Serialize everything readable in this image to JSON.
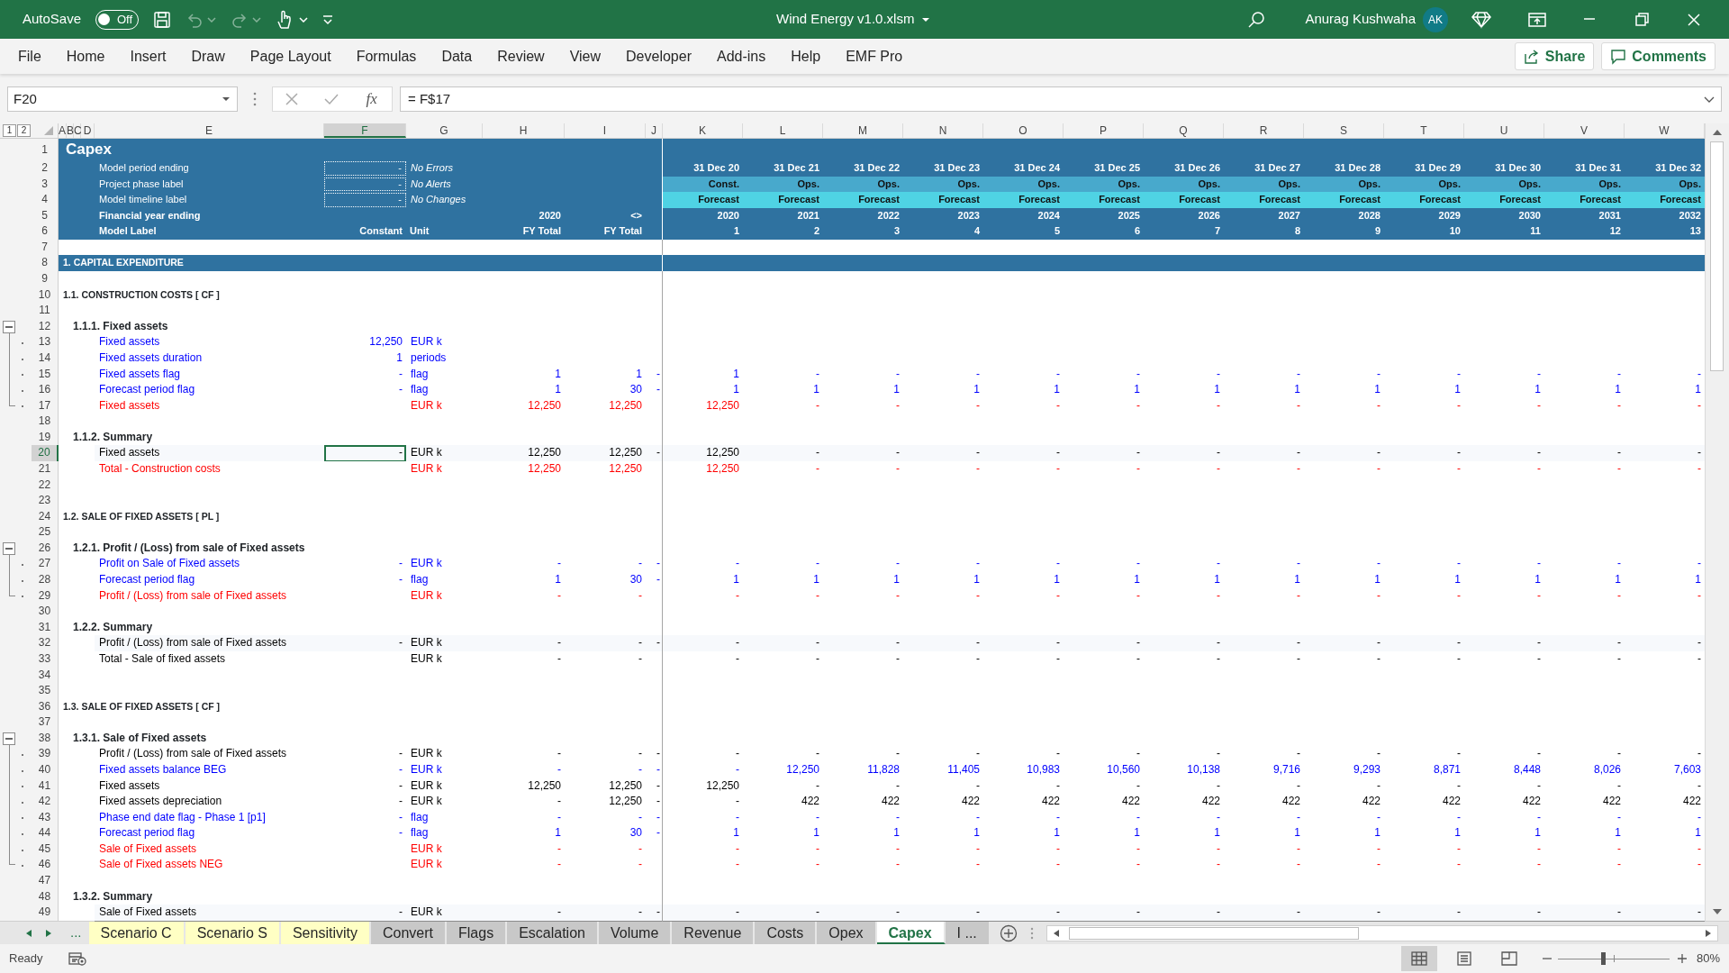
{
  "title_bar": {
    "autosave": {
      "label": "AutoSave",
      "on": false,
      "state_text": "Off"
    },
    "undo_disabled": true,
    "redo_disabled": true,
    "file_title": "Wind Energy v1.0.xlsm",
    "user_name": "Anurag Kushwaha",
    "avatar_initials": "AK"
  },
  "menu": [
    "File",
    "Home",
    "Insert",
    "Draw",
    "Page Layout",
    "Formulas",
    "Data",
    "Review",
    "View",
    "Developer",
    "Add-ins",
    "Help",
    "EMF Pro"
  ],
  "ribbon_actions": [
    "Share",
    "Comments"
  ],
  "formula_bar": {
    "name_box": "F20",
    "function_label": "fx",
    "formula": "= F$17"
  },
  "outline_levels": [
    "1",
    "2"
  ],
  "columns": [
    {
      "letter": "A",
      "selected": false
    },
    {
      "letter": "B",
      "selected": false
    },
    {
      "letter": "C",
      "selected": false
    },
    {
      "letter": "D",
      "selected": false
    },
    {
      "letter": "E",
      "selected": false
    },
    {
      "letter": "F",
      "selected": true
    },
    {
      "letter": "G",
      "selected": false
    },
    {
      "letter": "H",
      "selected": false
    },
    {
      "letter": "I",
      "selected": false
    },
    {
      "letter": "J",
      "selected": false
    },
    {
      "letter": "K",
      "selected": false
    },
    {
      "letter": "L",
      "selected": false
    },
    {
      "letter": "M",
      "selected": false
    },
    {
      "letter": "N",
      "selected": false
    },
    {
      "letter": "O",
      "selected": false
    },
    {
      "letter": "P",
      "selected": false
    },
    {
      "letter": "Q",
      "selected": false
    },
    {
      "letter": "R",
      "selected": false
    },
    {
      "letter": "S",
      "selected": false
    },
    {
      "letter": "T",
      "selected": false
    },
    {
      "letter": "U",
      "selected": false
    },
    {
      "letter": "V",
      "selected": false
    },
    {
      "letter": "W",
      "selected": false
    }
  ],
  "rows": [
    {
      "number": "1",
      "kind": "title",
      "selected": false,
      "label": "Capex"
    },
    {
      "number": "2",
      "kind": "check",
      "selected": false,
      "label": "Model period ending",
      "constant": "-",
      "unit": "No Errors",
      "periods": [
        "31 Dec 20",
        "31 Dec 21",
        "31 Dec 22",
        "31 Dec 23",
        "31 Dec 24",
        "31 Dec 25",
        "31 Dec 26",
        "31 Dec 27",
        "31 Dec 28",
        "31 Dec 29",
        "31 Dec 30",
        "31 Dec 31",
        "31 Dec 32"
      ]
    },
    {
      "number": "3",
      "kind": "phase",
      "selected": false,
      "label": "Project phase label",
      "constant": "-",
      "unit": "No Alerts",
      "periods": [
        "Const.",
        "Ops.",
        "Ops.",
        "Ops.",
        "Ops.",
        "Ops.",
        "Ops.",
        "Ops.",
        "Ops.",
        "Ops.",
        "Ops.",
        "Ops.",
        "Ops."
      ]
    },
    {
      "number": "4",
      "kind": "timeline",
      "selected": false,
      "label": "Model timeline label",
      "constant": "-",
      "unit": "No Changes",
      "periods": [
        "Forecast",
        "Forecast",
        "Forecast",
        "Forecast",
        "Forecast",
        "Forecast",
        "Forecast",
        "Forecast",
        "Forecast",
        "Forecast",
        "Forecast",
        "Forecast",
        "Forecast"
      ]
    },
    {
      "number": "5",
      "kind": "header",
      "selected": false,
      "label": "Financial year ending",
      "col_h": "2020",
      "col_i": "<>",
      "periods": [
        "2020",
        "2021",
        "2022",
        "2023",
        "2024",
        "2025",
        "2026",
        "2027",
        "2028",
        "2029",
        "2030",
        "2031",
        "2032"
      ]
    },
    {
      "number": "6",
      "kind": "header",
      "selected": false,
      "label": "Model Label",
      "constant": "Constant",
      "unit": "Unit",
      "col_h": "FY Total",
      "col_i": "FY Total",
      "periods": [
        "1",
        "2",
        "3",
        "4",
        "5",
        "6",
        "7",
        "8",
        "9",
        "10",
        "11",
        "12",
        "13"
      ]
    },
    {
      "number": "7",
      "kind": "blank",
      "selected": false
    },
    {
      "number": "8",
      "kind": "section",
      "selected": false,
      "label": "1. CAPITAL EXPENDITURE"
    },
    {
      "number": "9",
      "kind": "blank",
      "selected": false
    },
    {
      "number": "10",
      "kind": "heading",
      "selected": false,
      "label": "1.1. CONSTRUCTION COSTS [ CF ]"
    },
    {
      "number": "11",
      "kind": "blank",
      "selected": false
    },
    {
      "number": "12",
      "kind": "subheading",
      "selected": false,
      "expanded": true,
      "label": "1.1.1. Fixed assets",
      "children": [
        {
          "number": "13",
          "kind": "item",
          "color": "#0000ff",
          "selected": false,
          "label": "Fixed assets",
          "constant": "12,250",
          "unit": "EUR k"
        },
        {
          "number": "14",
          "kind": "item",
          "color": "#0000ff",
          "selected": false,
          "label": "Fixed assets duration",
          "constant": "1",
          "unit": "periods"
        },
        {
          "number": "15",
          "kind": "item",
          "color": "#0000ff",
          "selected": false,
          "label": "Fixed assets flag",
          "constant": "-",
          "unit": "flag",
          "col_h": "1",
          "col_i": "1",
          "col_j": "-",
          "periods": [
            "1",
            "-",
            "-",
            "-",
            "-",
            "-",
            "-",
            "-",
            "-",
            "-",
            "-",
            "-",
            "-"
          ]
        },
        {
          "number": "16",
          "kind": "item",
          "color": "#0000ff",
          "selected": false,
          "label": "Forecast period flag",
          "constant": "-",
          "unit": "flag",
          "col_h": "1",
          "col_i": "30",
          "col_j": "-",
          "periods": [
            "1",
            "1",
            "1",
            "1",
            "1",
            "1",
            "1",
            "1",
            "1",
            "1",
            "1",
            "1",
            "1"
          ]
        },
        {
          "number": "17",
          "kind": "item",
          "color": "#ff0000",
          "selected": false,
          "label": "Fixed assets",
          "unit": "EUR k",
          "col_h": "12,250",
          "col_i": "12,250",
          "periods": [
            "12,250",
            "-",
            "-",
            "-",
            "-",
            "-",
            "-",
            "-",
            "-",
            "-",
            "-",
            "-",
            "-"
          ]
        }
      ]
    },
    {
      "number": "18",
      "kind": "blank",
      "selected": false
    },
    {
      "number": "19",
      "kind": "subheading",
      "selected": false,
      "label": "1.1.2. Summary"
    },
    {
      "number": "20",
      "kind": "summary",
      "color": "#000000",
      "selected": true,
      "label": "Fixed assets",
      "constant": "-",
      "unit": "EUR k",
      "col_h": "12,250",
      "col_i": "12,250",
      "col_j": "-",
      "periods": [
        "12,250",
        "-",
        "-",
        "-",
        "-",
        "-",
        "-",
        "-",
        "-",
        "-",
        "-",
        "-",
        "-"
      ]
    },
    {
      "number": "21",
      "kind": "total",
      "color": "#ff0000",
      "selected": false,
      "label": "Total - Construction costs",
      "unit": "EUR k",
      "col_h": "12,250",
      "col_i": "12,250",
      "periods": [
        "12,250",
        "-",
        "-",
        "-",
        "-",
        "-",
        "-",
        "-",
        "-",
        "-",
        "-",
        "-",
        "-"
      ]
    },
    {
      "number": "22",
      "kind": "blank",
      "selected": false
    },
    {
      "number": "23",
      "kind": "blank",
      "selected": false
    },
    {
      "number": "24",
      "kind": "heading",
      "selected": false,
      "label": "1.2. SALE OF FIXED ASSETS [ PL ]"
    },
    {
      "number": "25",
      "kind": "blank",
      "selected": false
    },
    {
      "number": "26",
      "kind": "subheading",
      "selected": false,
      "expanded": true,
      "label": "1.2.1. Profit / (Loss) from sale of Fixed assets",
      "children": [
        {
          "number": "27",
          "kind": "item",
          "color": "#0000ff",
          "selected": false,
          "label": "Profit on Sale of Fixed assets",
          "constant": "-",
          "unit": "EUR k",
          "col_h": "-",
          "col_i": "-",
          "col_j": "-",
          "periods": [
            "-",
            "-",
            "-",
            "-",
            "-",
            "-",
            "-",
            "-",
            "-",
            "-",
            "-",
            "-",
            "-"
          ]
        },
        {
          "number": "28",
          "kind": "item",
          "color": "#0000ff",
          "selected": false,
          "label": "Forecast period flag",
          "constant": "-",
          "unit": "flag",
          "col_h": "1",
          "col_i": "30",
          "col_j": "-",
          "periods": [
            "1",
            "1",
            "1",
            "1",
            "1",
            "1",
            "1",
            "1",
            "1",
            "1",
            "1",
            "1",
            "1"
          ]
        },
        {
          "number": "29",
          "kind": "item",
          "color": "#ff0000",
          "selected": false,
          "label": "Profit / (Loss) from sale of Fixed assets",
          "unit": "EUR k",
          "col_h": "-",
          "col_i": "-",
          "periods": [
            "-",
            "-",
            "-",
            "-",
            "-",
            "-",
            "-",
            "-",
            "-",
            "-",
            "-",
            "-",
            "-"
          ]
        }
      ]
    },
    {
      "number": "30",
      "kind": "blank",
      "selected": false
    },
    {
      "number": "31",
      "kind": "subheading",
      "selected": false,
      "label": "1.2.2. Summary"
    },
    {
      "number": "32",
      "kind": "summary",
      "color": "#000000",
      "selected": false,
      "label": "Profit / (Loss) from sale of Fixed assets",
      "constant": "-",
      "unit": "EUR k",
      "col_h": "-",
      "col_i": "-",
      "col_j": "-",
      "periods": [
        "-",
        "-",
        "-",
        "-",
        "-",
        "-",
        "-",
        "-",
        "-",
        "-",
        "-",
        "-",
        "-"
      ]
    },
    {
      "number": "33",
      "kind": "total",
      "color": "#000000",
      "selected": false,
      "label": "Total - Sale of fixed assets",
      "unit": "EUR k",
      "col_h": "-",
      "col_i": "-",
      "periods": [
        "-",
        "-",
        "-",
        "-",
        "-",
        "-",
        "-",
        "-",
        "-",
        "-",
        "-",
        "-",
        "-"
      ]
    },
    {
      "number": "34",
      "kind": "blank",
      "selected": false
    },
    {
      "number": "35",
      "kind": "blank",
      "selected": false
    },
    {
      "number": "36",
      "kind": "heading",
      "selected": false,
      "label": "1.3. SALE OF FIXED ASSETS [ CF ]"
    },
    {
      "number": "37",
      "kind": "blank",
      "selected": false
    },
    {
      "number": "38",
      "kind": "subheading",
      "selected": false,
      "expanded": true,
      "label": "1.3.1. Sale of Fixed assets",
      "children": [
        {
          "number": "39",
          "kind": "item",
          "color": "#000000",
          "selected": false,
          "label": "Profit / (Loss) from sale of Fixed assets",
          "constant": "-",
          "unit": "EUR k",
          "col_h": "-",
          "col_i": "-",
          "col_j": "-",
          "periods": [
            "-",
            "-",
            "-",
            "-",
            "-",
            "-",
            "-",
            "-",
            "-",
            "-",
            "-",
            "-",
            "-"
          ]
        },
        {
          "number": "40",
          "kind": "item",
          "color": "#0000ff",
          "selected": false,
          "label": "Fixed assets balance BEG",
          "constant": "-",
          "unit": "EUR k",
          "col_h": "-",
          "col_i": "-",
          "col_j": "-",
          "periods": [
            "-",
            "12,250",
            "11,828",
            "11,405",
            "10,983",
            "10,560",
            "10,138",
            "9,716",
            "9,293",
            "8,871",
            "8,448",
            "8,026",
            "7,603"
          ]
        },
        {
          "number": "41",
          "kind": "item",
          "color": "#000000",
          "selected": false,
          "label": "Fixed assets",
          "constant": "-",
          "unit": "EUR k",
          "col_h": "12,250",
          "col_i": "12,250",
          "col_j": "-",
          "periods": [
            "12,250",
            "-",
            "-",
            "-",
            "-",
            "-",
            "-",
            "-",
            "-",
            "-",
            "-",
            "-",
            "-"
          ]
        },
        {
          "number": "42",
          "kind": "item",
          "color": "#000000",
          "selected": false,
          "label": "Fixed assets depreciation",
          "constant": "-",
          "unit": "EUR k",
          "col_h": "-",
          "col_i": "12,250",
          "col_j": "-",
          "periods": [
            "-",
            "422",
            "422",
            "422",
            "422",
            "422",
            "422",
            "422",
            "422",
            "422",
            "422",
            "422",
            "422"
          ]
        },
        {
          "number": "43",
          "kind": "item",
          "color": "#0000ff",
          "selected": false,
          "label": "Phase end date flag - Phase 1 [p1]",
          "constant": "-",
          "unit": "flag",
          "col_h": "-",
          "col_i": "-",
          "col_j": "-",
          "periods": [
            "-",
            "-",
            "-",
            "-",
            "-",
            "-",
            "-",
            "-",
            "-",
            "-",
            "-",
            "-",
            "-"
          ]
        },
        {
          "number": "44",
          "kind": "item",
          "color": "#0000ff",
          "selected": false,
          "label": "Forecast period flag",
          "constant": "-",
          "unit": "flag",
          "col_h": "1",
          "col_i": "30",
          "col_j": "-",
          "periods": [
            "1",
            "1",
            "1",
            "1",
            "1",
            "1",
            "1",
            "1",
            "1",
            "1",
            "1",
            "1",
            "1"
          ]
        },
        {
          "number": "45",
          "kind": "item",
          "color": "#ff0000",
          "selected": false,
          "label": "Sale of Fixed assets",
          "unit": "EUR k",
          "col_h": "-",
          "col_i": "-",
          "periods": [
            "-",
            "-",
            "-",
            "-",
            "-",
            "-",
            "-",
            "-",
            "-",
            "-",
            "-",
            "-",
            "-"
          ]
        },
        {
          "number": "46",
          "kind": "item",
          "color": "#ff0000",
          "selected": false,
          "label": "Sale of Fixed assets NEG",
          "unit": "EUR k",
          "col_h": "-",
          "col_i": "-",
          "periods": [
            "-",
            "-",
            "-",
            "-",
            "-",
            "-",
            "-",
            "-",
            "-",
            "-",
            "-",
            "-",
            "-"
          ]
        }
      ]
    },
    {
      "number": "47",
      "kind": "blank",
      "selected": false
    },
    {
      "number": "48",
      "kind": "subheading",
      "selected": false,
      "label": "1.3.2. Summary"
    },
    {
      "number": "49",
      "kind": "summary",
      "color": "#000000",
      "selected": false,
      "label": "Sale of Fixed assets",
      "constant": "-",
      "unit": "EUR k",
      "col_h": "-",
      "col_i": "-",
      "col_j": "-",
      "periods": [
        "-",
        "-",
        "-",
        "-",
        "-",
        "-",
        "-",
        "-",
        "-",
        "-",
        "-",
        "-",
        "-"
      ]
    }
  ],
  "sheet_tabs": {
    "more": "...",
    "tabs": [
      {
        "label": "Scenario C",
        "color": "#ffffc4",
        "selected": false
      },
      {
        "label": "Scenario S",
        "color": "#ffffc4",
        "selected": false
      },
      {
        "label": "Sensitivity",
        "color": "#ffffc4",
        "selected": false
      },
      {
        "label": "Convert",
        "color": "#c8c8c8",
        "selected": false
      },
      {
        "label": "Flags",
        "color": "#c8c8c8",
        "selected": false
      },
      {
        "label": "Escalation",
        "color": "#c8c8c8",
        "selected": false
      },
      {
        "label": "Volume",
        "color": "#c8c8c8",
        "selected": false
      },
      {
        "label": "Revenue",
        "color": "#c8c8c8",
        "selected": false
      },
      {
        "label": "Costs",
        "color": "#c8c8c8",
        "selected": false
      },
      {
        "label": "Opex",
        "color": "#c8c8c8",
        "selected": false
      },
      {
        "label": "Capex",
        "selected": true
      },
      {
        "label": "I ...",
        "color": "#c8c8c8",
        "selected": false
      }
    ]
  },
  "status_bar": {
    "status": "Ready",
    "views": [
      {
        "kind": "normal",
        "selected": true
      },
      {
        "kind": "page_layout",
        "selected": false
      },
      {
        "kind": "page_break",
        "selected": false
      }
    ],
    "zoom_slider": {
      "level": 0.4
    },
    "zoom": "80%"
  }
}
